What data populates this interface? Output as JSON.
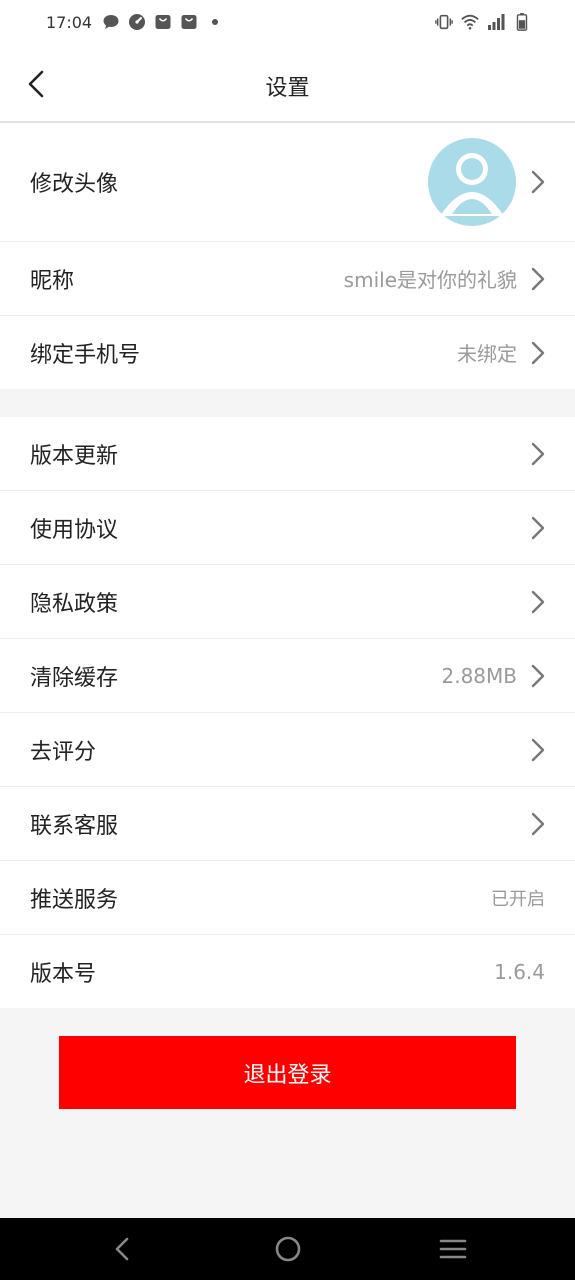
{
  "status_bar": {
    "time": "17:04",
    "left_icons": [
      "message-icon",
      "speedometer-icon",
      "shopping-bag-icon",
      "shopping-bag-icon",
      "dot-icon"
    ],
    "right_icons": [
      "vibrate-icon",
      "wifi-icon",
      "signal-icon",
      "battery-icon"
    ]
  },
  "header": {
    "title": "设置"
  },
  "profile": {
    "avatar_label": "修改头像",
    "nickname_label": "昵称",
    "nickname_value": "smile是对你的礼貌",
    "phone_label": "绑定手机号",
    "phone_value": "未绑定"
  },
  "settings": {
    "version_update": "版本更新",
    "terms": "使用协议",
    "privacy": "隐私政策",
    "clear_cache_label": "清除缓存",
    "clear_cache_value": "2.88MB",
    "rate": "去评分",
    "contact": "联系客服",
    "push_label": "推送服务",
    "push_value": "已开启",
    "version_label": "版本号",
    "version_value": "1.6.4"
  },
  "logout": {
    "label": "退出登录"
  },
  "colors": {
    "accent": "#ff0000",
    "avatar_bg": "#a9dce8",
    "secondary_text": "#9a9a9a",
    "page_bg": "#f5f5f5"
  }
}
